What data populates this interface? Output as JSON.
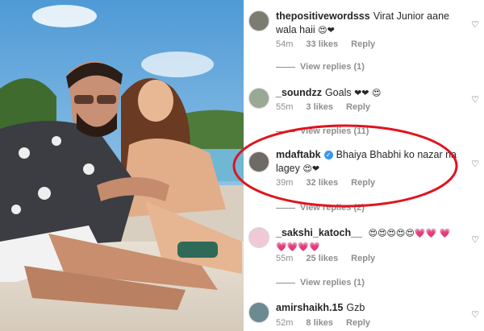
{
  "comments": [
    {
      "user": "thepositivewordsss",
      "text": "Virat Junior aane wala haii",
      "emoji": "😍❤",
      "time": "54m",
      "likes": "33 likes",
      "reply": "Reply",
      "view_replies": "View replies (1)"
    },
    {
      "user": "_soundzz",
      "text": "Goals",
      "emoji": "❤❤ 😍",
      "time": "55m",
      "likes": "3 likes",
      "reply": "Reply",
      "view_replies": "View replies (11)"
    },
    {
      "user": "mdaftabk",
      "verified": "✓",
      "text": "Bhaiya Bhabhi ko nazar na lagey",
      "emoji": "😍❤",
      "time": "39m",
      "likes": "32 likes",
      "reply": "Reply",
      "view_replies": "View replies (2)"
    },
    {
      "user": "_sakshi_katoch__",
      "text": "",
      "emoji": "😍😍😍😍😍💗💗 💗💗💗💗💗",
      "time": "55m",
      "likes": "25 likes",
      "reply": "Reply",
      "view_replies": "View replies (1)"
    },
    {
      "user": "amirshaikh.15",
      "text": "Gzb",
      "emoji": "",
      "time": "52m",
      "likes": "8 likes",
      "reply": "Reply"
    }
  ],
  "icons": {
    "like": "heart-outline-icon",
    "verified": "verified-badge-icon"
  },
  "colors": {
    "highlight": "#e0141e",
    "verified": "#3897f0",
    "meta": "#8e8e8e",
    "text": "#262626"
  }
}
